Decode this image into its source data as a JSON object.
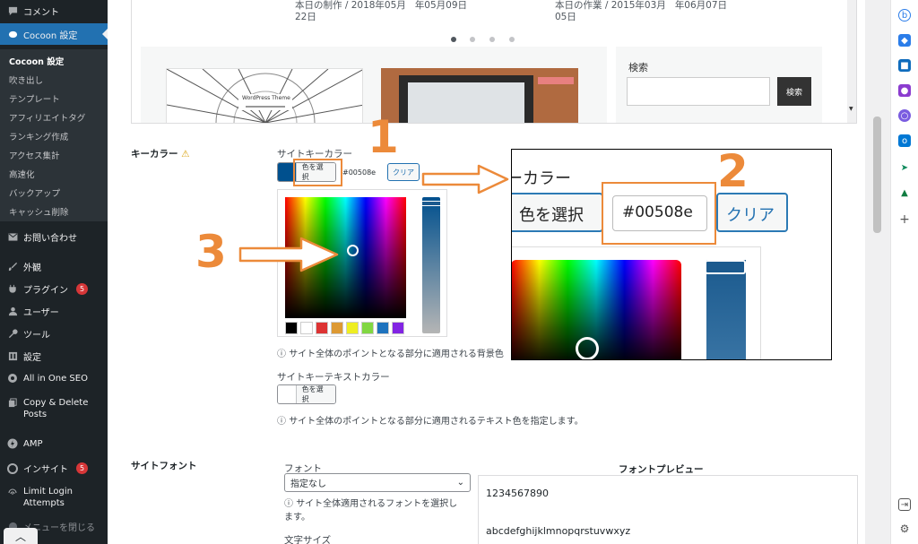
{
  "sidebar": {
    "top_items": [
      {
        "label": "コメント",
        "icon": "comment-icon"
      },
      {
        "label": "Cocoon 設定",
        "icon": "cocoon-icon"
      }
    ],
    "submenu": [
      "Cocoon 設定",
      "吹き出し",
      "テンプレート",
      "アフィリエイトタグ",
      "ランキング作成",
      "アクセス集計",
      "高速化",
      "バックアップ",
      "キャッシュ削除"
    ],
    "items": [
      {
        "label": "お問い合わせ",
        "icon": "mail-icon"
      },
      {
        "label": "外観",
        "icon": "brush-icon"
      },
      {
        "label": "プラグイン",
        "icon": "plugin-icon",
        "badge": "5"
      },
      {
        "label": "ユーザー",
        "icon": "user-icon"
      },
      {
        "label": "ツール",
        "icon": "wrench-icon"
      },
      {
        "label": "設定",
        "icon": "settings-icon"
      },
      {
        "label": "All in One SEO",
        "icon": "seo-icon"
      },
      {
        "label": "Copy & Delete",
        "label2": "Posts",
        "icon": "copy-icon"
      },
      {
        "label": "AMP",
        "icon": "amp-icon"
      },
      {
        "label": "インサイト",
        "icon": "insight-icon",
        "badge": "5"
      },
      {
        "label": "Limit Login",
        "label2": "Attempts",
        "icon": "fingerprint-icon"
      },
      {
        "label": "メニューを閉じる",
        "icon": "collapse-icon"
      }
    ]
  },
  "preview": {
    "post1_line1": "本日の制作 / 2018年05月",
    "post1_line1b": "年05月09日",
    "post1_line2": "22日",
    "post2_line1": "本日の作業 / 2015年03月",
    "post2_line1b": "年06月07日",
    "post2_line2": "05日",
    "thumb1_text": "WordPress Theme",
    "search_label": "検索",
    "search_button": "検索"
  },
  "key_color": {
    "section_label": "キーカラー",
    "field_label": "サイトキーカラー",
    "pick_button": "色を選択",
    "hex_value": "#00508e",
    "clear_button": "クリア",
    "help": "サイト全体のポイントとなる部分に適用される背景色",
    "swatch_color": "#00508e",
    "palette": [
      "#000000",
      "#ffffff",
      "#dd3333",
      "#dd9933",
      "#eeee22",
      "#81d742",
      "#1e73be",
      "#8224e3"
    ]
  },
  "key_text_color": {
    "field_label": "サイトキーテキストカラー",
    "pick_button": "色を選択",
    "help": "サイト全体のポイントとなる部分に適用されるテキスト色を指定します。"
  },
  "site_font": {
    "section_label": "サイトフォント",
    "font_label": "フォント",
    "font_value": "指定なし",
    "help_line1": "サイト全体適用されるフォントを選択し",
    "help_line2": "ます。",
    "size_label": "文字サイズ",
    "preview_title": "フォントプレビュー",
    "preview_numbers": "1234567890",
    "preview_letters": "abcdefghijklmnopqrstuvwxyz"
  },
  "zoom": {
    "label": "ーカラー",
    "pick_button": "色を選択",
    "hex_value": "#00508e",
    "clear_button": "クリア"
  },
  "annotations": {
    "n1": "1",
    "n2": "2",
    "n3": "3"
  },
  "accent": "#ec8a3a"
}
